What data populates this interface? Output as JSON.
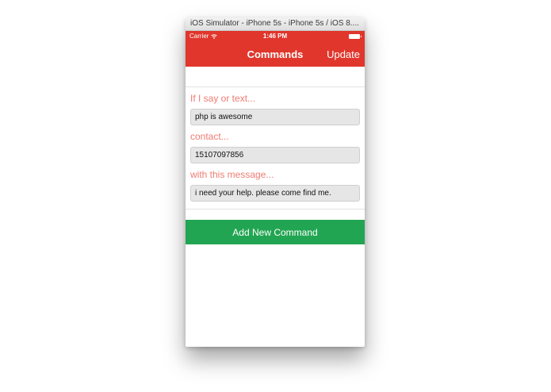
{
  "window": {
    "title": "iOS Simulator - iPhone 5s - iPhone 5s / iOS 8...."
  },
  "status_bar": {
    "carrier": "Carrier",
    "time": "1:46 PM"
  },
  "nav": {
    "title": "Commands",
    "right_button": "Update"
  },
  "form": {
    "trigger_label": "If I say or text...",
    "trigger_value": "php is awesome",
    "contact_label": "contact...",
    "contact_value": "15107097856",
    "message_label": "with this message...",
    "message_value": "i need your help. please come find me."
  },
  "actions": {
    "add_label": "Add New Command"
  },
  "colors": {
    "header": "#e0362c",
    "label": "#ef7b72",
    "add_button": "#22a552"
  }
}
